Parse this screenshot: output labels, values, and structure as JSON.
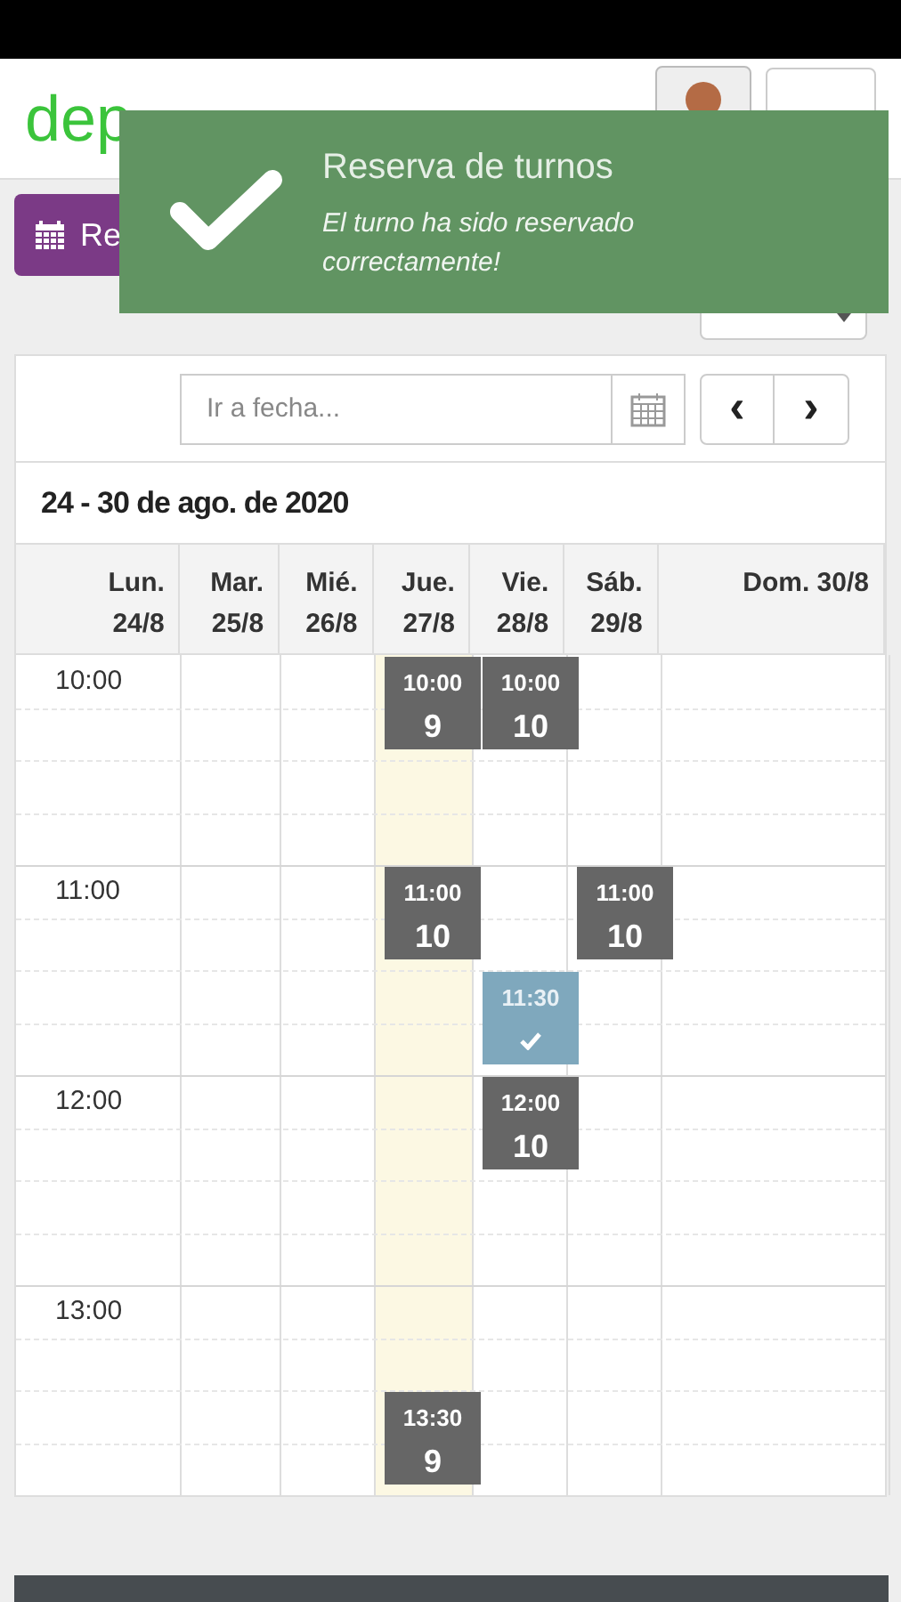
{
  "header": {
    "logo": "dep",
    "reserve_button": "Re"
  },
  "toast": {
    "title": "Reserva de turnos",
    "message": "El turno ha sido reservado correctamente!"
  },
  "calendar": {
    "date_field": {
      "placeholder": "Ir a fecha..."
    },
    "nav": [
      "‹",
      "›"
    ],
    "range_title": "24 - 30 de ago. de 2020",
    "hours": [
      "10:00",
      "11:00",
      "12:00",
      "13:00"
    ],
    "days": [
      {
        "label": "Lun.",
        "date": "24/8",
        "today": false
      },
      {
        "label": "Mar.",
        "date": "25/8",
        "today": false
      },
      {
        "label": "Mié.",
        "date": "26/8",
        "today": false
      },
      {
        "label": "Jue.",
        "date": "27/8",
        "today": true,
        "events": [
          {
            "time": "10:00",
            "count": "9",
            "kind": "available"
          },
          {
            "time": "11:00",
            "count": "10",
            "kind": "available"
          },
          {
            "time": "13:30",
            "count": "9",
            "kind": "available"
          }
        ]
      },
      {
        "label": "Vie.",
        "date": "28/8",
        "today": false,
        "events": [
          {
            "time": "10:00",
            "count": "10",
            "kind": "available"
          },
          {
            "time": "11:30",
            "kind": "booked"
          },
          {
            "time": "12:00",
            "count": "10",
            "kind": "available"
          }
        ]
      },
      {
        "label": "Sáb.",
        "date": "29/8",
        "today": false,
        "events": [
          {
            "time": "11:00",
            "count": "10",
            "kind": "available"
          }
        ]
      },
      {
        "label": "Dom. 30/8",
        "today": false
      }
    ]
  }
}
